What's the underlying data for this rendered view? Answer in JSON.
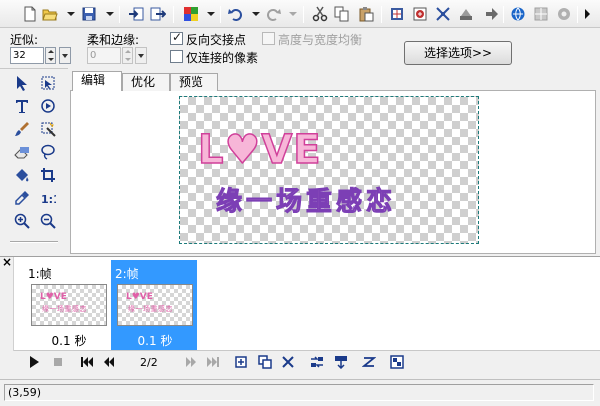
{
  "toolbar": {
    "icons": [
      "new-icon",
      "open-icon",
      "save-icon",
      "import-icon",
      "export-icon",
      "color-icon",
      "undo-icon",
      "redo-icon",
      "cut-icon",
      "copy-icon",
      "paste-icon",
      "crop-icon",
      "resize-icon",
      "transform-icon",
      "effects-icon",
      "preview-icon",
      "slice-icon",
      "options-icon"
    ]
  },
  "options": {
    "tolerance_label": "近似:",
    "tolerance_value": "32",
    "feather_label": "柔和边缘:",
    "feather_value": "0",
    "invert_label": "反向交接点",
    "invert_checked": true,
    "aspect_label": "高度与宽度均衡",
    "aspect_checked": false,
    "contiguous_label": "仅连接的像素",
    "contiguous_checked": false,
    "select_options_button": "选择选项>>"
  },
  "tabs": [
    "编辑",
    "优化",
    "预览"
  ],
  "active_tab": "编辑",
  "canvas": {
    "text_line1": "L♥VE",
    "text_line2": "缘一场重感恋"
  },
  "frames_panel": {
    "close_glyph": "×",
    "frames": [
      {
        "title": "1:帧",
        "delay": "0.1 秒",
        "thumb_line1": "L♥VE",
        "thumb_line2": "缘一场重感恋",
        "selected": false
      },
      {
        "title": "2:帧",
        "delay": "0.1 秒",
        "thumb_line1": "L♥VE",
        "thumb_line2": "缘一场重感恋",
        "selected": true
      }
    ]
  },
  "playback": {
    "counter": "2/2"
  },
  "status": {
    "coordinates": "(3,59)"
  },
  "colors": {
    "selection_blue": "#3399ff",
    "love_pink": "#f7b6d8",
    "love_outline": "#d0409a",
    "marquee": "#1b7a7a"
  }
}
